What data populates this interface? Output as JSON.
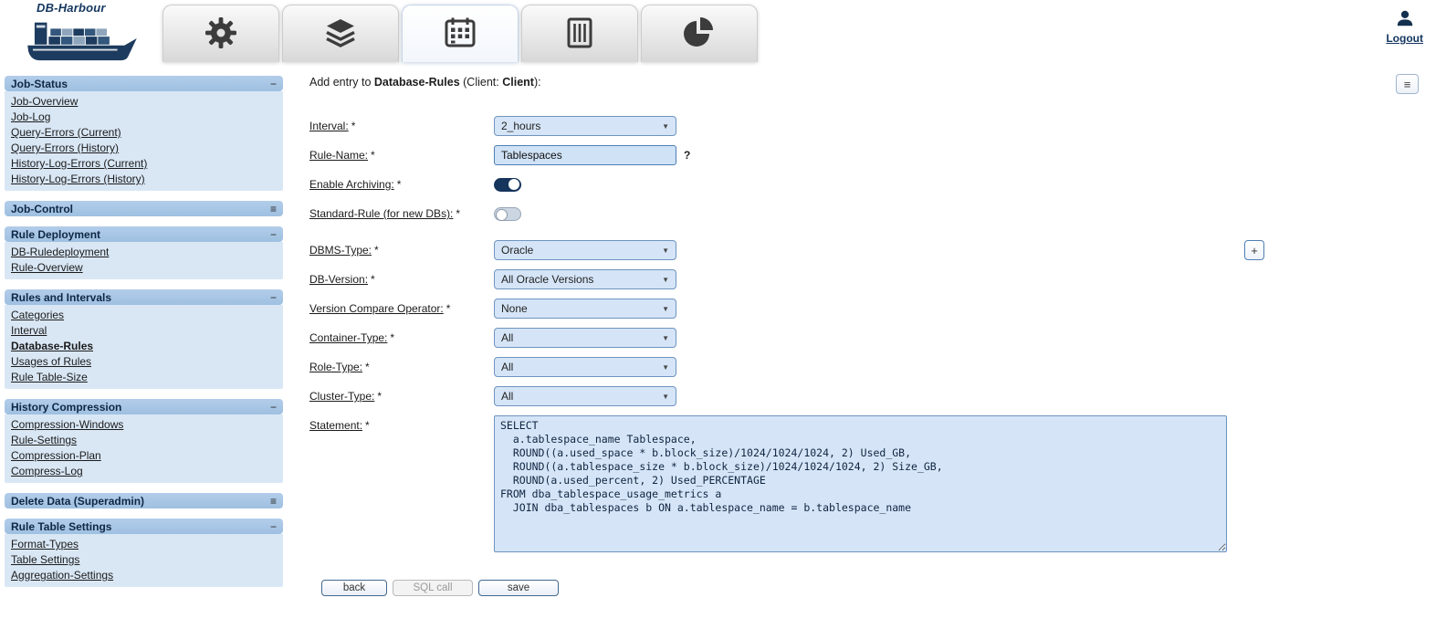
{
  "app": {
    "brand": "DB-Harbour",
    "logout_label": "Logout"
  },
  "icons": {
    "dropdown_arrow": "▼",
    "menu": "≡",
    "add": "+"
  },
  "colors": {
    "accent_navy": "#16355c",
    "sidebar_header_blue": "#a7c6e6",
    "sidebar_panel_blue": "#d9e7f5",
    "control_blue": "#d5e5f7",
    "control_border": "#6e94bf"
  },
  "tabs": [
    {
      "id": "admin-tools",
      "icon": "gear-icon",
      "active": false
    },
    {
      "id": "layers",
      "icon": "layers-icon",
      "active": false
    },
    {
      "id": "rules-schedule",
      "icon": "calendar-grid-icon",
      "active": true
    },
    {
      "id": "databases",
      "icon": "database-server-icon",
      "active": false
    },
    {
      "id": "reports",
      "icon": "pie-chart-icon",
      "active": false
    }
  ],
  "sidebar": {
    "sections": [
      {
        "title": "Job-Status",
        "toggle": "−",
        "state": "expanded",
        "items": [
          {
            "label": "Job-Overview"
          },
          {
            "label": "Job-Log"
          },
          {
            "label": "Query-Errors (Current)"
          },
          {
            "label": "Query-Errors (History)"
          },
          {
            "label": "History-Log-Errors (Current)"
          },
          {
            "label": "History-Log-Errors (History)"
          }
        ]
      },
      {
        "title": "Job-Control",
        "toggle": "≡",
        "state": "collapsed",
        "items": []
      },
      {
        "title": "Rule Deployment",
        "toggle": "−",
        "state": "expanded",
        "items": [
          {
            "label": "DB-Ruledeployment"
          },
          {
            "label": "Rule-Overview"
          }
        ]
      },
      {
        "title": "Rules and Intervals",
        "toggle": "−",
        "state": "expanded",
        "items": [
          {
            "label": "Categories"
          },
          {
            "label": "Interval"
          },
          {
            "label": "Database-Rules",
            "active": true
          },
          {
            "label": "Usages of Rules"
          },
          {
            "label": "Rule Table-Size"
          }
        ]
      },
      {
        "title": "History Compression",
        "toggle": "−",
        "state": "expanded",
        "items": [
          {
            "label": "Compression-Windows"
          },
          {
            "label": "Rule-Settings"
          },
          {
            "label": "Compression-Plan"
          },
          {
            "label": "Compress-Log"
          }
        ]
      },
      {
        "title": "Delete Data (Superadmin)",
        "toggle": "≡",
        "state": "collapsed",
        "items": []
      },
      {
        "title": "Rule Table Settings",
        "toggle": "−",
        "state": "expanded",
        "items": [
          {
            "label": "Format-Types"
          },
          {
            "label": "Table Settings"
          },
          {
            "label": "Aggregation-Settings"
          }
        ]
      }
    ]
  },
  "main": {
    "heading": {
      "prefix": "Add entry to ",
      "entity": "Database-Rules",
      "mid": " (Client: ",
      "client": "Client",
      "suffix": "):"
    },
    "required_marker": "*",
    "fields": {
      "interval": {
        "label": "Interval:",
        "value": "2_hours"
      },
      "rule_name": {
        "label": "Rule-Name:",
        "value": "Tablespaces",
        "help": "?"
      },
      "enable_archiving": {
        "label": "Enable Archiving:",
        "state": "on"
      },
      "standard_rule": {
        "label": "Standard-Rule (for new DBs):",
        "state": "off"
      },
      "dbms_type": {
        "label": "DBMS-Type:",
        "value": "Oracle"
      },
      "db_version": {
        "label": "DB-Version:",
        "value": "All Oracle Versions"
      },
      "version_compare_operator": {
        "label": "Version Compare Operator:",
        "value": "None"
      },
      "container_type": {
        "label": "Container-Type:",
        "value": "All"
      },
      "role_type": {
        "label": "Role-Type:",
        "value": "All"
      },
      "cluster_type": {
        "label": "Cluster-Type:",
        "value": "All"
      },
      "statement": {
        "label": "Statement:",
        "value": "SELECT\n  a.tablespace_name Tablespace,\n  ROUND((a.used_space * b.block_size)/1024/1024/1024, 2) Used_GB,\n  ROUND((a.tablespace_size * b.block_size)/1024/1024/1024, 2) Size_GB,\n  ROUND(a.used_percent, 2) Used_PERCENTAGE\nFROM dba_tablespace_usage_metrics a\n  JOIN dba_tablespaces b ON a.tablespace_name = b.tablespace_name"
      }
    },
    "buttons": {
      "back": "back",
      "sql_call": "SQL call",
      "save": "save"
    }
  }
}
